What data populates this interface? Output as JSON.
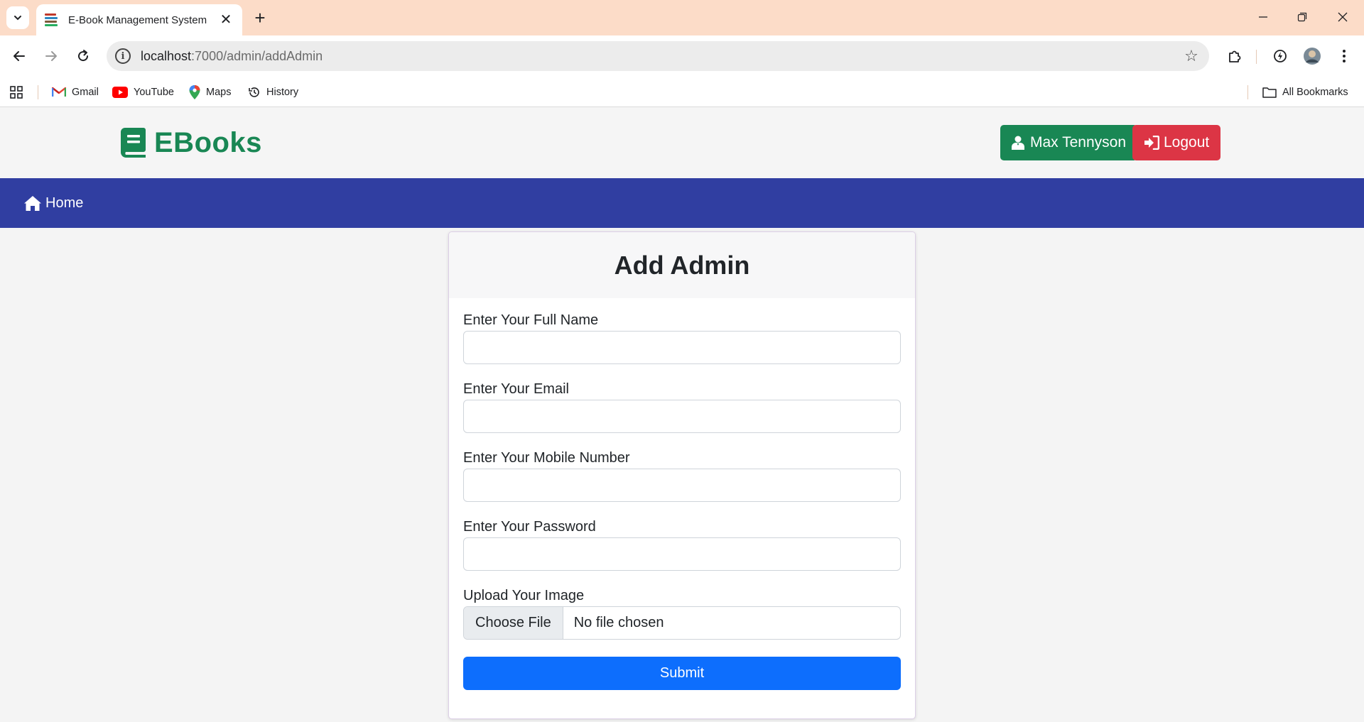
{
  "browser": {
    "tab_title": "E-Book Management System",
    "url_host": "localhost",
    "url_path": ":7000/admin/addAdmin",
    "bookmarks": [
      {
        "label": "Gmail",
        "icon": "gmail-icon"
      },
      {
        "label": "YouTube",
        "icon": "youtube-icon"
      },
      {
        "label": "Maps",
        "icon": "maps-icon"
      },
      {
        "label": "History",
        "icon": "history-icon"
      }
    ],
    "all_bookmarks_label": "All Bookmarks"
  },
  "header": {
    "brand": "EBooks",
    "user_name": "Max Tennyson",
    "logout_label": "Logout"
  },
  "nav": {
    "home_label": "Home"
  },
  "form": {
    "title": "Add Admin",
    "fields": [
      {
        "label": "Enter Your Full Name",
        "value": ""
      },
      {
        "label": "Enter Your Email",
        "value": ""
      },
      {
        "label": "Enter Your Mobile Number",
        "value": ""
      },
      {
        "label": "Enter Your Password",
        "value": ""
      }
    ],
    "upload_label": "Upload Your Image",
    "choose_file_label": "Choose File",
    "file_status": "No file chosen",
    "submit_label": "Submit"
  },
  "colors": {
    "brand_green": "#198754",
    "logout_red": "#dc3545",
    "nav_blue": "#303ea1",
    "submit_blue": "#0d6efd",
    "tabstrip": "#fcdcc8"
  }
}
